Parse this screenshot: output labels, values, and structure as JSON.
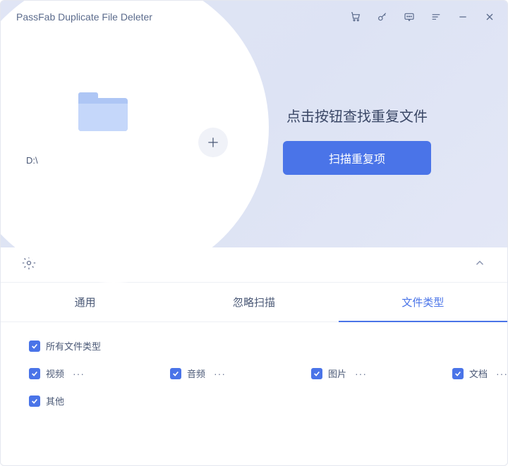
{
  "app_title": "PassFab Duplicate File Deleter",
  "titlebar_icons": {
    "cart": "cart-icon",
    "key": "key-icon",
    "chat": "chat-icon",
    "menu": "menu-icon",
    "minimize": "minimize-icon",
    "close": "close-icon"
  },
  "folder": {
    "path": "D:\\"
  },
  "cta": {
    "heading": "点击按钮查找重复文件",
    "scan_label": "扫描重复项"
  },
  "tabs": [
    {
      "label": "通用",
      "active": false
    },
    {
      "label": "忽略扫描",
      "active": false
    },
    {
      "label": "文件类型",
      "active": true
    }
  ],
  "filetype": {
    "all_label": "所有文件类型",
    "items": [
      {
        "label": "视频"
      },
      {
        "label": "音频"
      },
      {
        "label": "图片"
      },
      {
        "label": "文档"
      }
    ],
    "other_label": "其他",
    "dots": "···"
  }
}
